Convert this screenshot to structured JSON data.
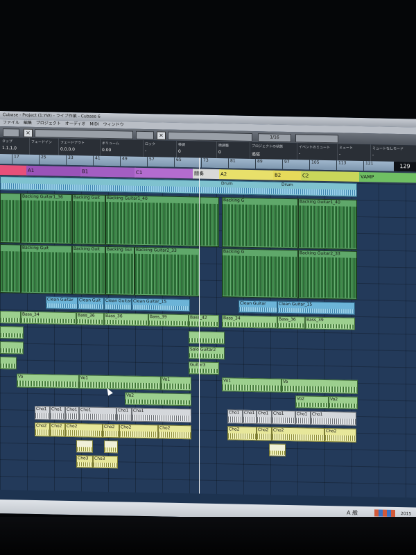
{
  "window": {
    "title": "Cubase - Project (1:YW) - ライブ作業 - Cubase 6"
  },
  "menubar": {
    "items": [
      "ファイル",
      "編集",
      "プロジェクト",
      "オーディオ",
      "MIDI",
      "ウィンドウ"
    ]
  },
  "toolbar": {
    "snap_value": "1/16"
  },
  "infobar": {
    "fields": [
      {
        "label": "タップ",
        "value": "1.1.1.0"
      },
      {
        "label": "フェードイン",
        "value": ""
      },
      {
        "label": "フェードアウト",
        "value": "0.0.0.0"
      },
      {
        "label": "ボリューム",
        "value": "0.00"
      },
      {
        "label": "ロック",
        "value": "-"
      },
      {
        "label": "移調",
        "value": "0"
      },
      {
        "label": "微調整",
        "value": "0"
      },
      {
        "label": "プロジェクトの状態",
        "value": "追従"
      },
      {
        "label": "イベントのミュート",
        "value": "-"
      },
      {
        "label": "ミュート",
        "value": "-"
      },
      {
        "label": "ミュートなしモード",
        "value": "-"
      }
    ]
  },
  "ruler": {
    "ticks": [
      "17",
      "25",
      "33",
      "41",
      "49",
      "57",
      "65",
      "73",
      "81",
      "89",
      "97",
      "105",
      "113",
      "121",
      "129"
    ],
    "end_value": "129"
  },
  "markers": [
    {
      "label": "",
      "color": "#e7507a"
    },
    {
      "label": "A1",
      "color": "#9a53b8"
    },
    {
      "label": "B1",
      "color": "#a35ec2"
    },
    {
      "label": "C1",
      "color": "#b46ccf"
    },
    {
      "label": "間奏",
      "color": "#d8d8d8"
    },
    {
      "label": "A2",
      "color": "#e8e06a"
    },
    {
      "label": "B2",
      "color": "#e6da5a"
    },
    {
      "label": "C2",
      "color": "#c9d65a"
    },
    {
      "label": "VAMP",
      "color": "#6fbf63"
    }
  ],
  "tracks": {
    "drum": [
      "Drum",
      "Drum",
      "Drum"
    ],
    "backing1": [
      "Backing Guitar1_36",
      "Backing Guit",
      "Backing Guitar1_40",
      "Backing G",
      "Backing Guitar1_40"
    ],
    "backing2": [
      "Backing Guit",
      "Backing Guit",
      "Backing Gui",
      "Backing Guitar2_33",
      "Backing G",
      "Backing Guitar2_33"
    ],
    "clean": [
      "Clean Guitar",
      "Clean Guit",
      "Clean Guitar",
      "Clean Guitar_15",
      "Clean Guitar",
      "Clean Guitar_15"
    ],
    "bass": [
      "Bass_34",
      "Bass_36",
      "Bass_36",
      "Bass_39",
      "Bass_42",
      "Bass_34",
      "Bass_36",
      "Bass_39"
    ],
    "solo": [
      "Solo Guitar2",
      "Guitar3"
    ],
    "vo": [
      "Vo",
      "Vo1",
      "Vo1",
      "Vo1",
      "Vo"
    ],
    "vo2": [
      "Vo2",
      "Vo2",
      "Vo2"
    ],
    "cho1": [
      "Cho1",
      "Cho1",
      "Cho1",
      "Cho1",
      "Cho1",
      "Cho1",
      "Cho1",
      "Cho1",
      "Cho1",
      "Cho1",
      "Cho1",
      "Cho1"
    ],
    "cho2": [
      "Cho2",
      "Cho2",
      "Cho2",
      "Cho2",
      "Cho2",
      "Cho2",
      "Cho2",
      "Cho2",
      "Cho2",
      "Cho2"
    ],
    "cho3": [
      "Cho3",
      "Cho3"
    ]
  },
  "taskbar": {
    "ime": "A 般",
    "clock": "2015"
  }
}
